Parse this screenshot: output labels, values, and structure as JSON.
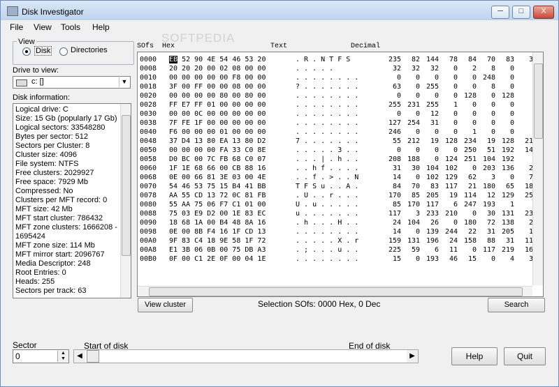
{
  "app": {
    "title": "Disk Investigator",
    "watermark": "SOFTPEDIA",
    "controls": {
      "minimize": "─",
      "maximize": "□",
      "close": "X"
    }
  },
  "menu": [
    "File",
    "View",
    "Tools",
    "Help"
  ],
  "view": {
    "group_label": "View",
    "options": [
      "Disk",
      "Directories"
    ],
    "selected": "Disk"
  },
  "drive": {
    "label": "Drive to view:",
    "selected": "c: []"
  },
  "disk_info": {
    "label": "Disk information:",
    "lines": [
      "Logical drive: C",
      "Size: 15 Gb (popularly 17 Gb)",
      "Logical sectors: 33548280",
      "Bytes per sector: 512",
      "Sectors per Cluster: 8",
      "Cluster size: 4096",
      "File system: NTFS",
      "Free clusters: 2029927",
      "Free space: 7929 Mb",
      "Compressed: No",
      "Clusters per MFT record: 0",
      "MFT size: 42 Mb",
      "MFT start cluster: 786432",
      "MFT zone clusters: 1666208  -",
      "1695424",
      "MFT zone size: 114 Mb",
      "MFT mirror start: 2096767",
      "Media Descriptor: 248",
      "Root Entries: 0",
      "Heads: 255",
      "Sectors per track: 63"
    ]
  },
  "hex_view": {
    "headers": {
      "offset": "SOfs",
      "hex": "Hex",
      "text": "Text",
      "decimal": "Decimal"
    },
    "rows": [
      {
        "offset": "0000",
        "hex": "EB 52 90 4E 54 46 53 20",
        "text": ". R . N T F S",
        "dec": [
          "235",
          "82",
          "144",
          "78",
          "84",
          "70",
          "83",
          "3"
        ]
      },
      {
        "offset": "0008",
        "hex": "20 20 20 00 02 08 00 00",
        "text": ". . . . .",
        "dec": [
          "32",
          "32",
          "32",
          "0",
          "2",
          "8",
          "0",
          ""
        ]
      },
      {
        "offset": "0010",
        "hex": "00 00 00 00 00 F8 00 00",
        "text": ". . . . . . . .",
        "dec": [
          "0",
          "0",
          "0",
          "0",
          "0",
          "248",
          "0",
          ""
        ]
      },
      {
        "offset": "0018",
        "hex": "3F 00 FF 00 00 08 00 00",
        "text": "? . . . . . . .",
        "dec": [
          "63",
          "0",
          "255",
          "0",
          "0",
          "8",
          "0",
          ""
        ]
      },
      {
        "offset": "0020",
        "hex": "00 00 00 00 80 00 80 00",
        "text": ". . . . . . . .",
        "dec": [
          "0",
          "0",
          "0",
          "0",
          "128",
          "0",
          "128",
          ""
        ]
      },
      {
        "offset": "0028",
        "hex": "FF E7 FF 01 00 00 00 00",
        "text": ". . . . . . . .",
        "dec": [
          "255",
          "231",
          "255",
          "1",
          "0",
          "0",
          "0",
          ""
        ]
      },
      {
        "offset": "0030",
        "hex": "00 00 0C 00 00 00 00 00",
        "text": ". . . . . . . .",
        "dec": [
          "0",
          "0",
          "12",
          "0",
          "0",
          "0",
          "0",
          ""
        ]
      },
      {
        "offset": "0038",
        "hex": "7F FE 1F 00 00 00 00 00",
        "text": ". . . . . . . .",
        "dec": [
          "127",
          "254",
          "31",
          "0",
          "0",
          "0",
          "0",
          ""
        ]
      },
      {
        "offset": "0040",
        "hex": "F6 00 00 00 01 00 00 00",
        "text": ". . . . . . . .",
        "dec": [
          "246",
          "0",
          "0",
          "0",
          "1",
          "0",
          "0",
          ""
        ]
      },
      {
        "offset": "0048",
        "hex": "37 D4 13 80 EA 13 80 D2",
        "text": "7 . . . . . . .",
        "dec": [
          "55",
          "212",
          "19",
          "128",
          "234",
          "19",
          "128",
          "21"
        ]
      },
      {
        "offset": "0050",
        "hex": "00 00 00 00 FA 33 C0 8E",
        "text": ". . . . . 3 . .",
        "dec": [
          "0",
          "0",
          "0",
          "0",
          "250",
          "51",
          "192",
          "14"
        ]
      },
      {
        "offset": "0058",
        "hex": "D0 BC 00 7C FB 68 C0 07",
        "text": ". . . | . h . .",
        "dec": [
          "208",
          "188",
          "0",
          "124",
          "251",
          "104",
          "192",
          ""
        ]
      },
      {
        "offset": "0060",
        "hex": "1F 1E 68 66 00 CB 88 16",
        "text": ". . h f . . . .",
        "dec": [
          "31",
          "30",
          "104",
          "102",
          "0",
          "203",
          "136",
          "2"
        ]
      },
      {
        "offset": "0068",
        "hex": "0E 00 66 81 3E 03 00 4E",
        "text": ". . f . > . . N",
        "dec": [
          "14",
          "0",
          "102",
          "129",
          "62",
          "3",
          "0",
          "7"
        ]
      },
      {
        "offset": "0070",
        "hex": "54 46 53 75 15 B4 41 BB",
        "text": "T F S u . . A .",
        "dec": [
          "84",
          "70",
          "83",
          "117",
          "21",
          "180",
          "65",
          "18"
        ]
      },
      {
        "offset": "0078",
        "hex": "AA 55 CD 13 72 0C 81 FB",
        "text": ". U . . r . . .",
        "dec": [
          "170",
          "85",
          "205",
          "19",
          "114",
          "12",
          "129",
          "25"
        ]
      },
      {
        "offset": "0080",
        "hex": "55 AA 75 06 F7 C1 01 00",
        "text": "U . u . . . . .",
        "dec": [
          "85",
          "170",
          "117",
          "6",
          "247",
          "193",
          "1",
          ""
        ]
      },
      {
        "offset": "0088",
        "hex": "75 03 E9 D2 00 1E 83 EC",
        "text": "u . . . . . . .",
        "dec": [
          "117",
          "3",
          "233",
          "210",
          "0",
          "30",
          "131",
          "23"
        ]
      },
      {
        "offset": "0090",
        "hex": "18 68 1A 00 B4 48 8A 16",
        "text": ". h . . . H . .",
        "dec": [
          "24",
          "104",
          "26",
          "0",
          "180",
          "72",
          "138",
          "2"
        ]
      },
      {
        "offset": "0098",
        "hex": "0E 00 8B F4 16 1F CD 13",
        "text": ". . . . . . . .",
        "dec": [
          "14",
          "0",
          "139",
          "244",
          "22",
          "31",
          "205",
          "1"
        ]
      },
      {
        "offset": "00A0",
        "hex": "9F 83 C4 18 9E 58 1F 72",
        "text": ". . . . . X . r",
        "dec": [
          "159",
          "131",
          "196",
          "24",
          "158",
          "88",
          "31",
          "11"
        ]
      },
      {
        "offset": "00A8",
        "hex": "E1 3B 06 0B 00 75 DB A3",
        "text": ". ; . . . u . .",
        "dec": [
          "225",
          "59",
          "6",
          "11",
          "0",
          "117",
          "219",
          "16"
        ]
      },
      {
        "offset": "00B0",
        "hex": "0F 00 C1 2E 0F 00 04 1E",
        "text": ". . . . . . . .",
        "dec": [
          "15",
          "0",
          "193",
          "46",
          "15",
          "0",
          "4",
          "3"
        ]
      }
    ]
  },
  "selection_text": "Selection SOfs: 0000 Hex,  0 Dec",
  "buttons": {
    "view_cluster": "View cluster",
    "search": "Search",
    "help": "Help",
    "quit": "Quit"
  },
  "sector": {
    "label": "Sector",
    "value": "0"
  },
  "range": {
    "start_label": "Start of disk",
    "end_label": "End of disk",
    "position": 0.0
  }
}
